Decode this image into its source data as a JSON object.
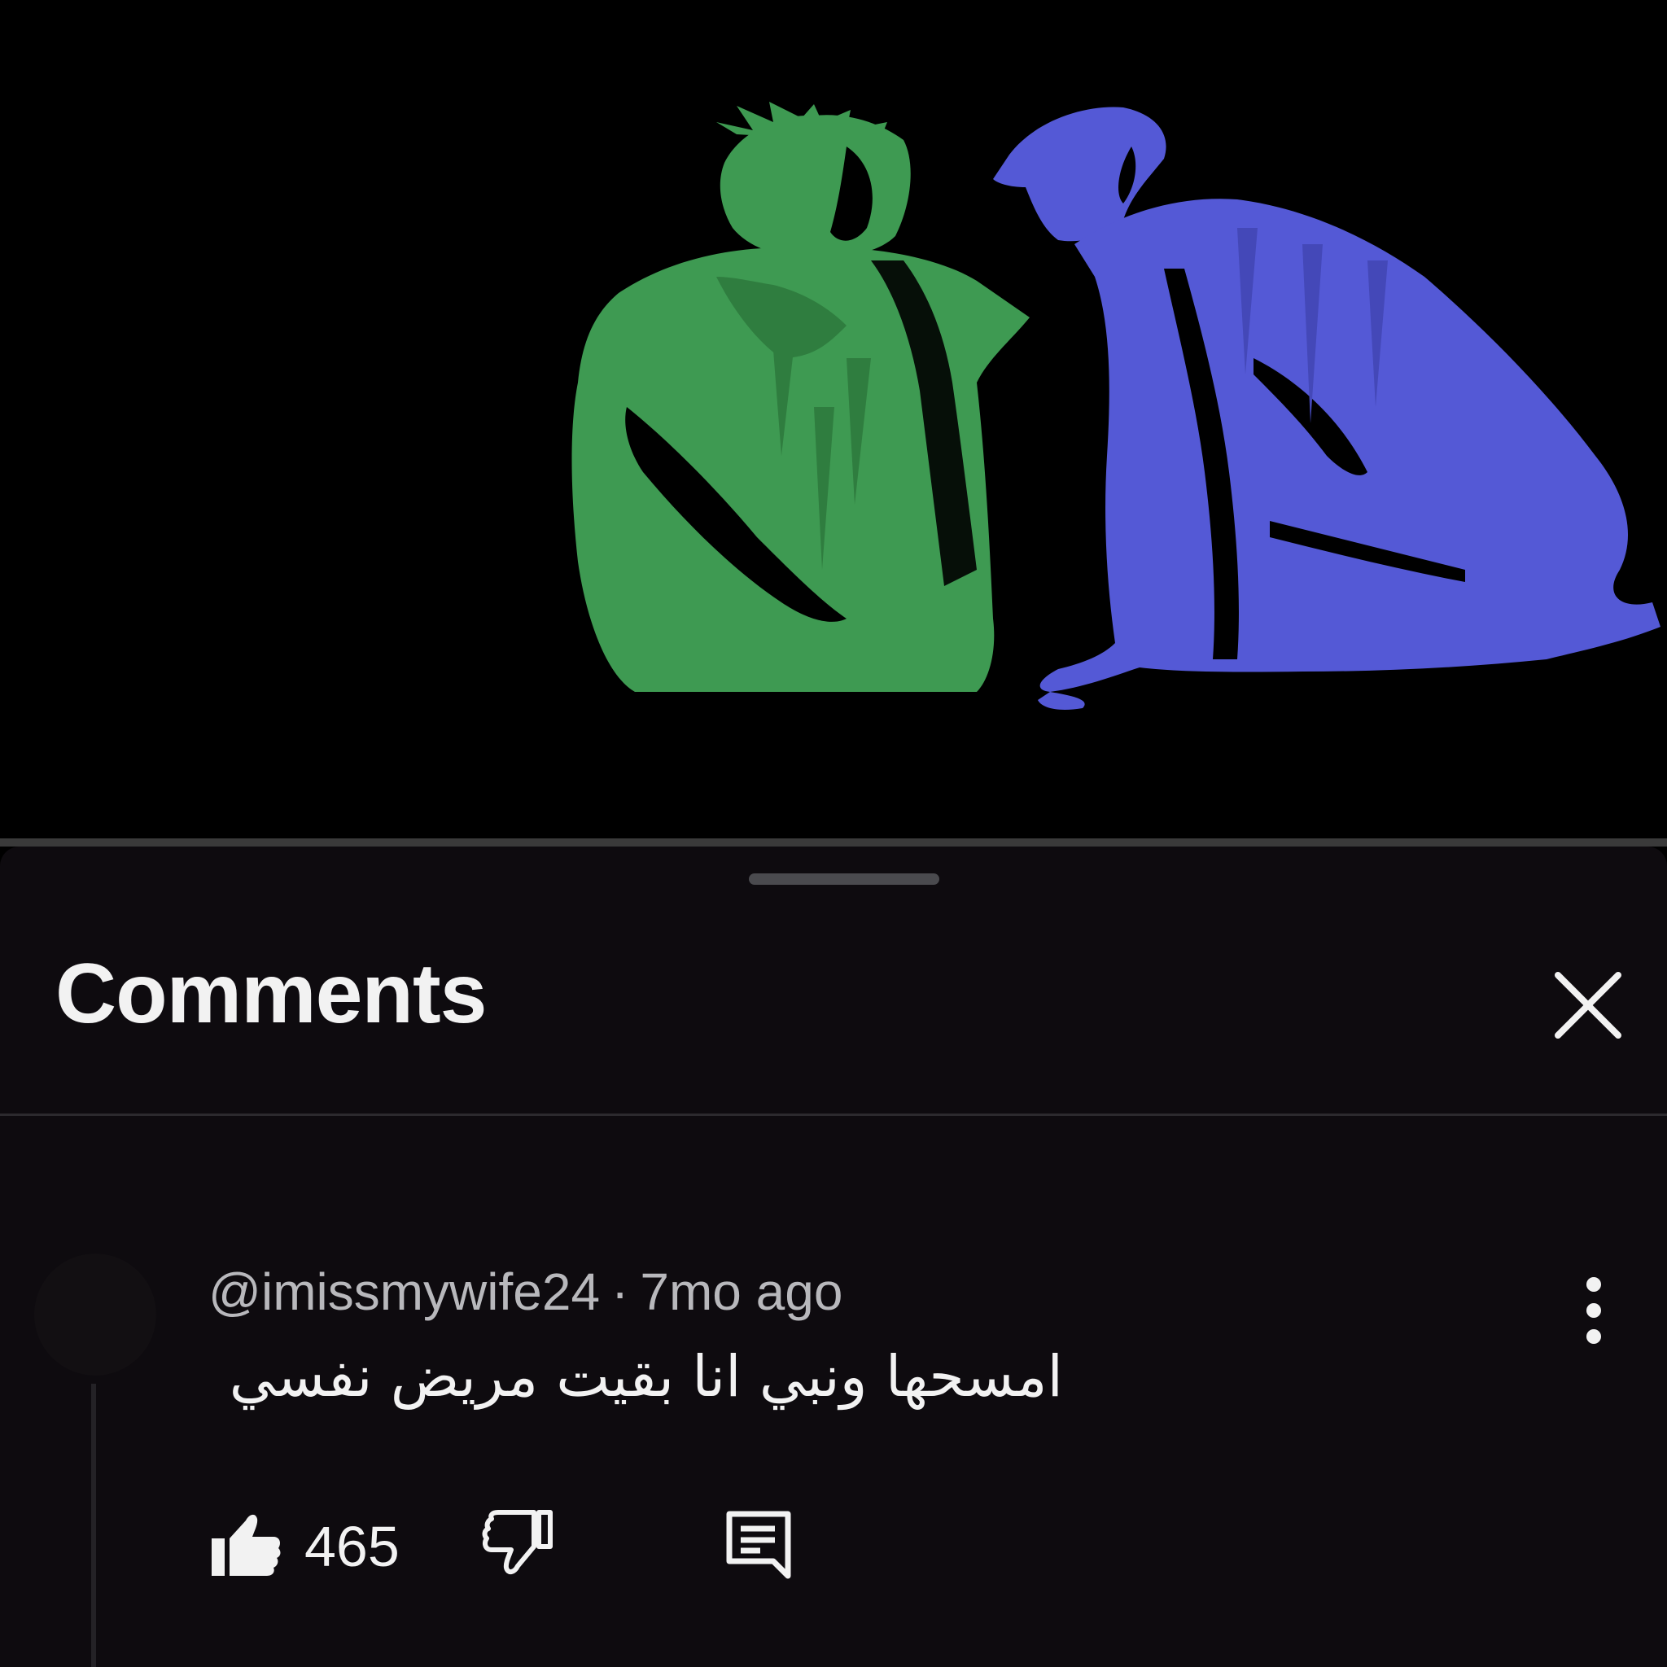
{
  "video": {
    "progress_fraction": 0.0,
    "illustration": {
      "background": "#000000",
      "left_figure_color": "#3e9a52",
      "right_figure_color": "#5459d6"
    }
  },
  "comments_panel": {
    "title": "Comments",
    "close_icon": "close-icon",
    "comment": {
      "author": "@imissmywife24",
      "separator": "·",
      "time": "7mo ago",
      "text": "امسحها ونبي انا بقيت مريض نفسي",
      "like_count": "465",
      "icons": [
        "thumbs-up-icon",
        "thumbs-down-icon",
        "reply-icon",
        "more-vertical-icon"
      ]
    }
  },
  "colors": {
    "sheet_background": "#0e0b0f",
    "text_primary": "#f2f2f2",
    "text_secondary": "#b8b8bc",
    "progress_accent": "#ff0000"
  }
}
